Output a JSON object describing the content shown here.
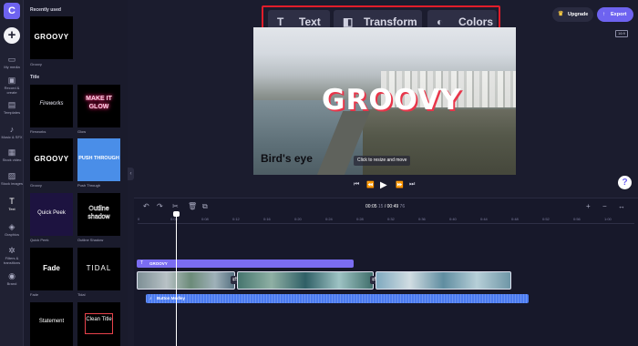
{
  "app": {
    "logo_letter": "C"
  },
  "rail": {
    "add_symbol": "+",
    "items": [
      {
        "label": "My media",
        "icon": "folder-icon"
      },
      {
        "label": "Record & create",
        "icon": "video-camera-icon"
      },
      {
        "label": "Templates",
        "icon": "templates-icon"
      },
      {
        "label": "Music & SFX",
        "icon": "music-note-icon"
      },
      {
        "label": "Stock video",
        "icon": "film-icon"
      },
      {
        "label": "Stock images",
        "icon": "image-icon"
      },
      {
        "label": "Text",
        "icon": "text-icon"
      },
      {
        "label": "Graphics",
        "icon": "shapes-icon"
      },
      {
        "label": "Filters & transitions",
        "icon": "filters-icon"
      },
      {
        "label": "Brand",
        "icon": "brand-icon"
      }
    ]
  },
  "library": {
    "recently_used_heading": "Recently used",
    "recent_items": [
      {
        "title": "GROOVY",
        "caption": "Groovy"
      }
    ],
    "title_heading": "Title",
    "title_items": [
      {
        "title": "Fireworks",
        "caption": "Fireworks"
      },
      {
        "title": "MAKE IT GLOW",
        "caption": "Glow"
      },
      {
        "title": "GROOVY",
        "caption": "Groovy"
      },
      {
        "title": "PUSH THROUGH",
        "caption": "Push Through"
      },
      {
        "title": "Quick Peek",
        "caption": "Quick Peek"
      },
      {
        "title": "Outline shadow",
        "caption": "Outline Shadow"
      },
      {
        "title": "Fade",
        "caption": "Fade"
      },
      {
        "title": "TIDAL",
        "caption": "Tidal"
      },
      {
        "title": "Statement",
        "caption": ""
      },
      {
        "title": "Clean Title",
        "caption": ""
      }
    ]
  },
  "toolbar": {
    "tabs": [
      {
        "label": "Text",
        "icon": "T"
      },
      {
        "label": "Transform",
        "icon": "transform-icon"
      },
      {
        "label": "Colors",
        "icon": "droplet-icon"
      }
    ],
    "upgrade_label": "Upgrade",
    "export_label": "Export",
    "aspect_ratio": "16:9"
  },
  "preview": {
    "title_text": "GROOVY",
    "caption_text": "Bird's eye",
    "resize_hint": "Click to resize and move"
  },
  "timeline": {
    "current_time": "00:05",
    "current_frames": "15",
    "total_time": "00:49",
    "total_frames": "76",
    "ruler_ticks": [
      "0",
      "0:04",
      "0:08",
      "0:12",
      "0:16",
      "0:20",
      "0:24",
      "0:28",
      "0:32",
      "0:36",
      "0:40",
      "0:44",
      "0:48",
      "0:52",
      "0:56",
      "1:00"
    ],
    "text_track_label": "GROOVY",
    "audio_track_label": "Button Medley",
    "zoom_in": "+",
    "zoom_out": "−"
  },
  "colors": {
    "accent": "#6e63f0",
    "highlight_border": "#e11d2a",
    "text_clip": "#7b6df2",
    "audio_clip": "#4b7bf0"
  }
}
